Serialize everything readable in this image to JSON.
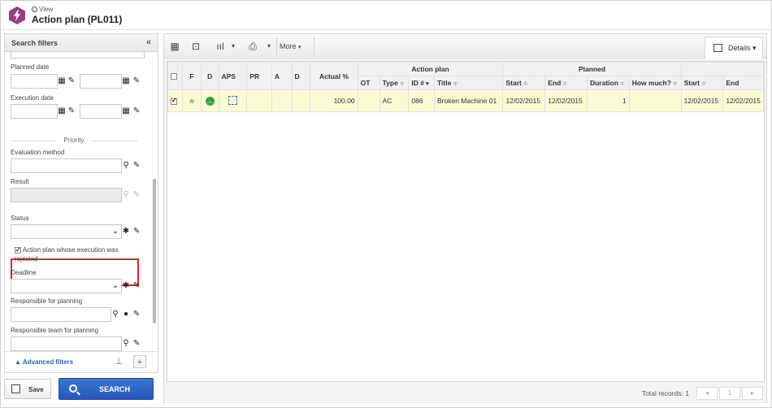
{
  "header": {
    "breadcrumb": "View",
    "title": "Action plan (PL011)"
  },
  "filters": {
    "panel_title": "Search filters",
    "collapse_glyph": "«",
    "planned_date_label": "Planned date",
    "execution_date_label": "Execution date",
    "priority_section": "Priority",
    "evaluation_method_label": "Evaluation method",
    "result_label": "Result",
    "status_label": "Status",
    "rejected_checkbox_label": "Action plan whose execution was rejected",
    "rejected_checked": true,
    "deadline_label": "Deadline",
    "responsible_planning_label": "Responsible for planning",
    "responsible_team_label": "Responsible team for planning",
    "advanced_filters": "Advanced filters",
    "advanced_glyph": "▲"
  },
  "actions": {
    "save_label": "Save",
    "search_label": "SEARCH"
  },
  "toolbar": {
    "more_label": "More",
    "details_label": "Details"
  },
  "grid": {
    "group_action_plan": "Action plan",
    "group_planned": "Planned",
    "col_f": "F",
    "col_d": "D",
    "col_aps": "APS",
    "col_pr": "PR",
    "col_a": "A",
    "col_d2": "D",
    "col_actual": "Actual %",
    "col_ot": "OT",
    "col_type": "Type",
    "col_id": "ID #",
    "col_title": "Title",
    "col_start": "Start",
    "col_end": "End",
    "col_duration": "Duration",
    "col_howmuch": "How much?",
    "col_start2": "Start",
    "col_end2": "End",
    "row": {
      "checked": true,
      "actual": "100.00",
      "type": "AC",
      "id": "086",
      "title": "Broken Machine 01",
      "start": "12/02/2015",
      "end": "12/02/2015",
      "duration": "1",
      "start2": "12/02/2015",
      "end2": "12/02/2015"
    }
  },
  "status": {
    "total_records": "Total records: 1",
    "page": "1"
  },
  "colors": {
    "accent_blue": "#2557b8",
    "selected_row": "#fbfbd3",
    "highlight_red": "#e0262a",
    "app_icon": "#9b3c86"
  }
}
